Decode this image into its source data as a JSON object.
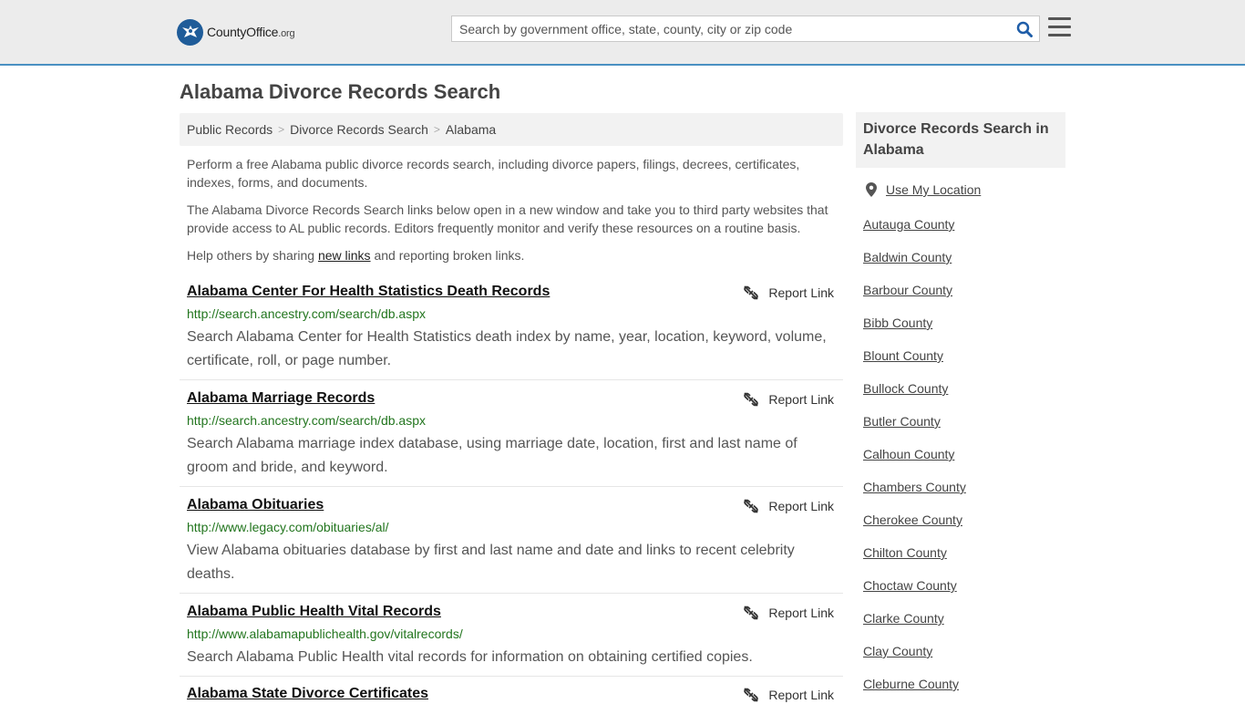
{
  "header": {
    "logo_main": "CountyOffice",
    "logo_ext": ".org",
    "search_placeholder": "Search by government office, state, county, city or zip code"
  },
  "page_title": "Alabama Divorce Records Search",
  "breadcrumb": [
    {
      "label": "Public Records"
    },
    {
      "label": "Divorce Records Search"
    },
    {
      "label": "Alabama"
    }
  ],
  "intro": {
    "p1": "Perform a free Alabama public divorce records search, including divorce papers, filings, decrees, certificates, indexes, forms, and documents.",
    "p2": "The Alabama Divorce Records Search links below open in a new window and take you to third party websites that provide access to AL public records. Editors frequently monitor and verify these resources on a routine basis.",
    "p3_before": "Help others by sharing ",
    "p3_link": "new links",
    "p3_after": " and reporting broken links."
  },
  "report_label": "Report Link",
  "results": [
    {
      "title": "Alabama Center For Health Statistics Death Records",
      "url": "http://search.ancestry.com/search/db.aspx",
      "desc": "Search Alabama Center for Health Statistics death index by name, year, location, keyword, volume, certificate, roll, or page number."
    },
    {
      "title": "Alabama Marriage Records",
      "url": "http://search.ancestry.com/search/db.aspx",
      "desc": "Search Alabama marriage index database, using marriage date, location, first and last name of groom and bride, and keyword."
    },
    {
      "title": "Alabama Obituaries",
      "url": "http://www.legacy.com/obituaries/al/",
      "desc": "View Alabama obituaries database by first and last name and date and links to recent celebrity deaths."
    },
    {
      "title": "Alabama Public Health Vital Records",
      "url": "http://www.alabamapublichealth.gov/vitalrecords/",
      "desc": "Search Alabama Public Health vital records for information on obtaining certified copies."
    },
    {
      "title": "Alabama State Divorce Certificates",
      "url": "",
      "desc": ""
    }
  ],
  "sidebar": {
    "heading": "Divorce Records Search in Alabama",
    "use_location": "Use My Location",
    "counties": [
      "Autauga County",
      "Baldwin County",
      "Barbour County",
      "Bibb County",
      "Blount County",
      "Bullock County",
      "Butler County",
      "Calhoun County",
      "Chambers County",
      "Cherokee County",
      "Chilton County",
      "Choctaw County",
      "Clarke County",
      "Clay County",
      "Cleburne County"
    ]
  },
  "colors": {
    "header_bg": "#ececec",
    "header_border": "#4a90c2",
    "logo_badge": "#1f5c99",
    "search_icon": "#1e5da8",
    "url_green": "#22751e",
    "panel_bg": "#f2f2f2"
  },
  "icons": {
    "logo": "eagle-seal-icon",
    "search": "search-icon",
    "menu": "hamburger-menu-icon",
    "report": "broken-link-icon",
    "location": "map-pin-icon"
  }
}
